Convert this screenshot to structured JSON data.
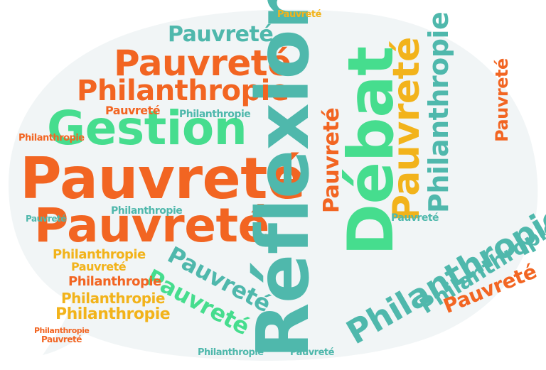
{
  "colors": {
    "orange": "#f26522",
    "teal": "#4fb8ac",
    "green": "#46dd8e",
    "yellow": "#f2b31b",
    "bubble": "#f1f5f6"
  },
  "words": {
    "poverty": "Pauvreté",
    "philanthropy": "Philanthropie",
    "management": "Gestion",
    "reflection": "Réflexion",
    "debate": "Débat"
  }
}
